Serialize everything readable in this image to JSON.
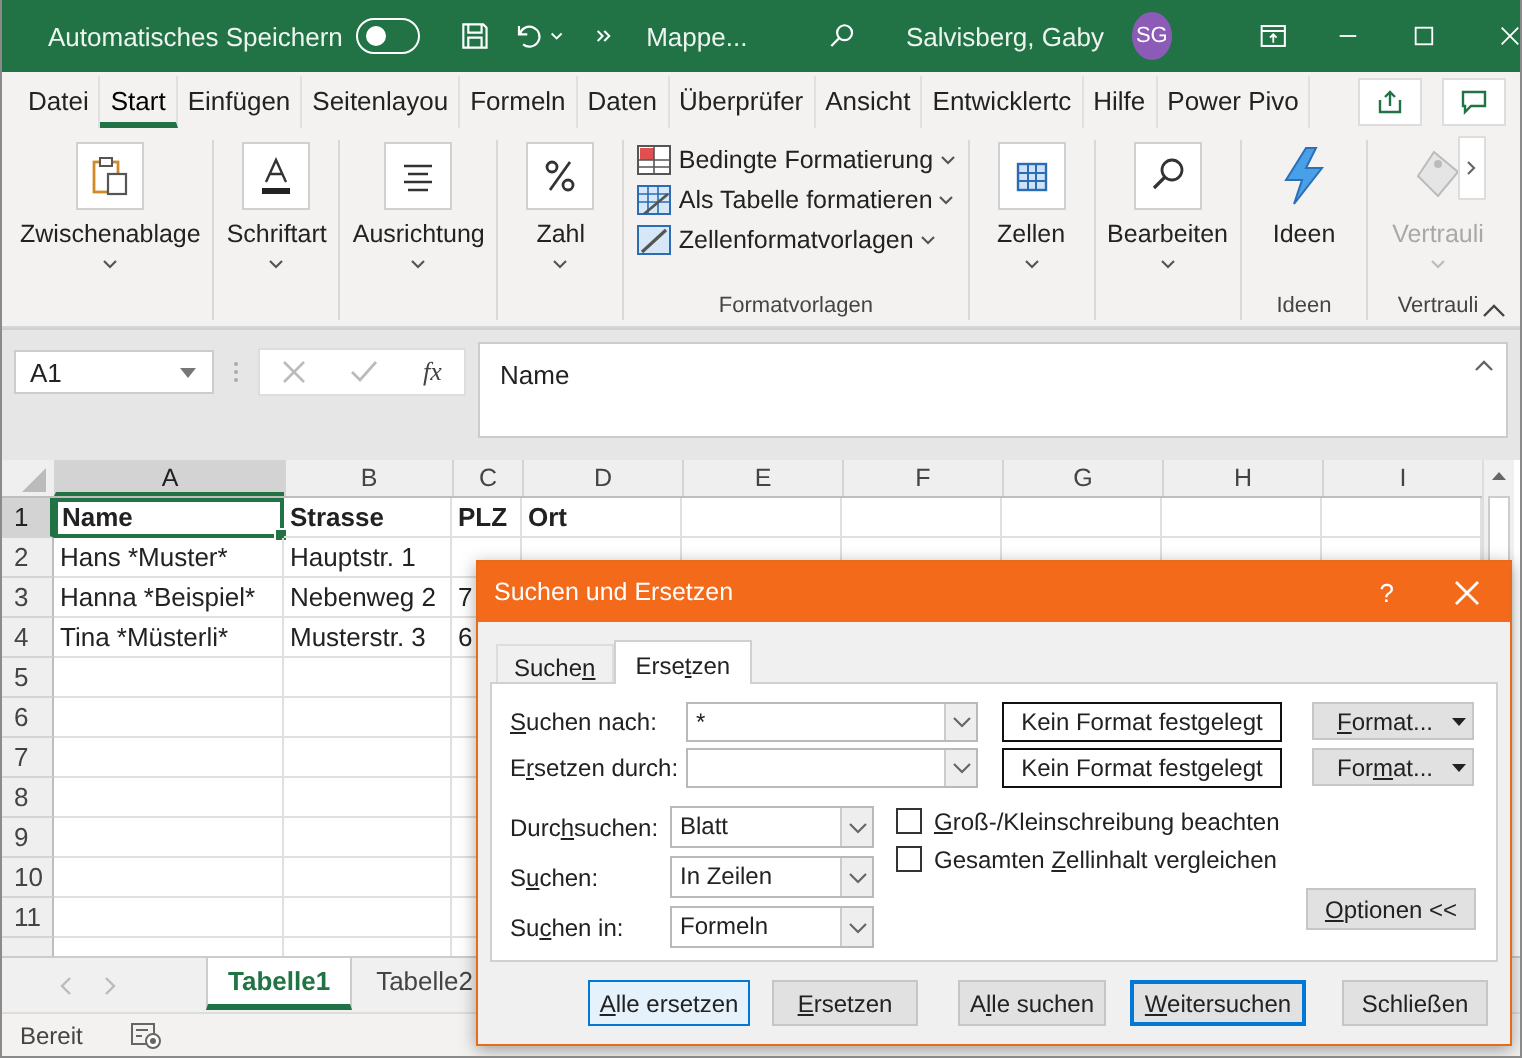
{
  "titlebar": {
    "autosave_label": "Automatisches Speichern",
    "autosave_on": false,
    "doc_title": "Mappe...",
    "user": "Salvisberg, Gaby",
    "avatar": "SG"
  },
  "ribbon_tabs": [
    {
      "label": "Datei",
      "selected": false
    },
    {
      "label": "Start",
      "selected": true
    },
    {
      "label": "Einfügen",
      "selected": false
    },
    {
      "label": "Seitenlayou",
      "selected": false
    },
    {
      "label": "Formeln",
      "selected": false
    },
    {
      "label": "Daten",
      "selected": false
    },
    {
      "label": "Überprüfer",
      "selected": false
    },
    {
      "label": "Ansicht",
      "selected": false
    },
    {
      "label": "Entwicklertc",
      "selected": false
    },
    {
      "label": "Hilfe",
      "selected": false
    },
    {
      "label": "Power Pivo",
      "selected": false
    }
  ],
  "ribbon": [
    {
      "buttons": [
        {
          "kind": "clipboard",
          "label": "Zwischenablage",
          "dropdown": true,
          "disabled": false
        }
      ]
    },
    {
      "buttons": [
        {
          "kind": "font",
          "label": "Schriftart",
          "dropdown": true,
          "disabled": false
        }
      ]
    },
    {
      "buttons": [
        {
          "kind": "align",
          "label": "Ausrichtung",
          "dropdown": true,
          "disabled": false
        }
      ]
    },
    {
      "buttons": [
        {
          "kind": "percent",
          "label": "Zahl",
          "dropdown": true,
          "disabled": false
        }
      ]
    },
    {
      "list": [
        {
          "kind": "conditional",
          "label": "Bedingte Formatierung"
        },
        {
          "kind": "table",
          "label": "Als Tabelle formatieren"
        },
        {
          "kind": "styles",
          "label": "Zellenformatvorlagen"
        }
      ],
      "group_label": "Formatvorlagen"
    },
    {
      "buttons": [
        {
          "kind": "cells",
          "label": "Zellen",
          "dropdown": true,
          "disabled": false
        }
      ]
    },
    {
      "buttons": [
        {
          "kind": "search",
          "label": "Bearbeiten",
          "dropdown": true,
          "disabled": false
        }
      ]
    },
    {
      "buttons": [
        {
          "kind": "bolt",
          "label": "Ideen",
          "dropdown": false,
          "disabled": false
        }
      ],
      "group_label": "Ideen"
    },
    {
      "buttons": [
        {
          "kind": "tag",
          "label": "Vertrauli",
          "dropdown": true,
          "disabled": true
        }
      ],
      "group_label": "Vertrauli"
    }
  ],
  "formula_bar": {
    "name_box": "A1",
    "fx": "fx",
    "content": "Name"
  },
  "columns": [
    {
      "label": "A",
      "selected": true
    },
    {
      "label": "B",
      "selected": false
    },
    {
      "label": "C",
      "selected": false
    },
    {
      "label": "D",
      "selected": false
    },
    {
      "label": "E",
      "selected": false
    },
    {
      "label": "F",
      "selected": false
    },
    {
      "label": "G",
      "selected": false
    },
    {
      "label": "H",
      "selected": false
    },
    {
      "label": "I",
      "selected": false
    }
  ],
  "rows": [
    {
      "header": "1",
      "selected": true,
      "cells": [
        {
          "text": "Name",
          "active": true,
          "bold": true
        },
        {
          "text": "Strasse",
          "active": false,
          "bold": true
        },
        {
          "text": "PLZ",
          "active": false,
          "bold": true
        },
        {
          "text": "Ort",
          "active": false,
          "bold": true
        }
      ]
    },
    {
      "header": "2",
      "selected": false,
      "cells": [
        {
          "text": "Hans *Muster*",
          "active": false,
          "bold": false
        },
        {
          "text": "Hauptstr. 1",
          "active": false,
          "bold": false
        }
      ]
    },
    {
      "header": "3",
      "selected": false,
      "cells": [
        {
          "text": "Hanna *Beispiel*",
          "active": false,
          "bold": false
        },
        {
          "text": "Nebenweg 2",
          "active": false,
          "bold": false
        },
        {
          "text": "7",
          "active": false,
          "bold": false
        }
      ]
    },
    {
      "header": "4",
      "selected": false,
      "cells": [
        {
          "text": "Tina *Müsterli*",
          "active": false,
          "bold": false
        },
        {
          "text": "Musterstr. 3",
          "active": false,
          "bold": false
        },
        {
          "text": "6",
          "active": false,
          "bold": false
        }
      ]
    },
    {
      "header": "5",
      "selected": false
    },
    {
      "header": "6",
      "selected": false
    },
    {
      "header": "7",
      "selected": false
    },
    {
      "header": "8",
      "selected": false
    },
    {
      "header": "9",
      "selected": false
    },
    {
      "header": "10",
      "selected": false
    },
    {
      "header": "11",
      "selected": false
    }
  ],
  "sheet_tabs": [
    {
      "label": "Tabelle1",
      "selected": true
    },
    {
      "label": "Tabelle2",
      "selected": false
    }
  ],
  "status_bar": {
    "text": "Bereit"
  },
  "dialog": {
    "title": "Suchen und Ersetzen",
    "help": "?",
    "tabs": [
      {
        "label": {
          "before": "Suche",
          "key": "n"
        },
        "selected": false
      },
      {
        "label": {
          "before": "Erse",
          "key": "t",
          "after": "zen"
        },
        "selected": true
      }
    ],
    "fields": [
      {
        "label": {
          "key": "S",
          "after": "uchen nach:"
        },
        "value": "*",
        "format_preview": "Kein Format festgelegt",
        "format_button": {
          "key": "F",
          "after": "ormat..."
        }
      },
      {
        "label": {
          "before": "E",
          "key": "r",
          "after": "setzen durch:"
        },
        "format_preview": "Kein Format festgelegt",
        "format_button": {
          "before": "For",
          "key": "m",
          "after": "at..."
        }
      }
    ],
    "dropdowns": [
      {
        "label": {
          "before": "Durc",
          "key": "h",
          "after": "suchen:"
        },
        "value": "Blatt"
      },
      {
        "label": {
          "before": "S",
          "key": "u",
          "after": "chen:"
        },
        "value": "In Zeilen"
      },
      {
        "label": {
          "before": "Su",
          "key": "c",
          "after": "hen in:"
        },
        "value": "Formeln"
      }
    ],
    "checkboxes": [
      {
        "label": {
          "key": "G",
          "after": "roß-/Kleinschreibung beachten"
        },
        "checked": false
      },
      {
        "label": {
          "before": "Gesamten ",
          "key": "Z",
          "after": "ellinhalt vergleichen"
        },
        "checked": false
      }
    ],
    "options_button": {
      "key": "O",
      "after": "ptionen <<"
    },
    "buttons": [
      {
        "kind": "focused",
        "label": {
          "key": "A",
          "after": "lle ersetzen"
        }
      },
      {
        "kind": "normal",
        "label": {
          "key": "E",
          "after": "rsetzen"
        }
      },
      {
        "kind": "normal",
        "label": {
          "before": "A",
          "key": "l",
          "after": "le suchen"
        }
      },
      {
        "kind": "default",
        "label": {
          "key": "W",
          "after": "eitersuchen"
        }
      },
      {
        "kind": "normal",
        "label": {
          "before": "Schließen"
        }
      }
    ]
  }
}
